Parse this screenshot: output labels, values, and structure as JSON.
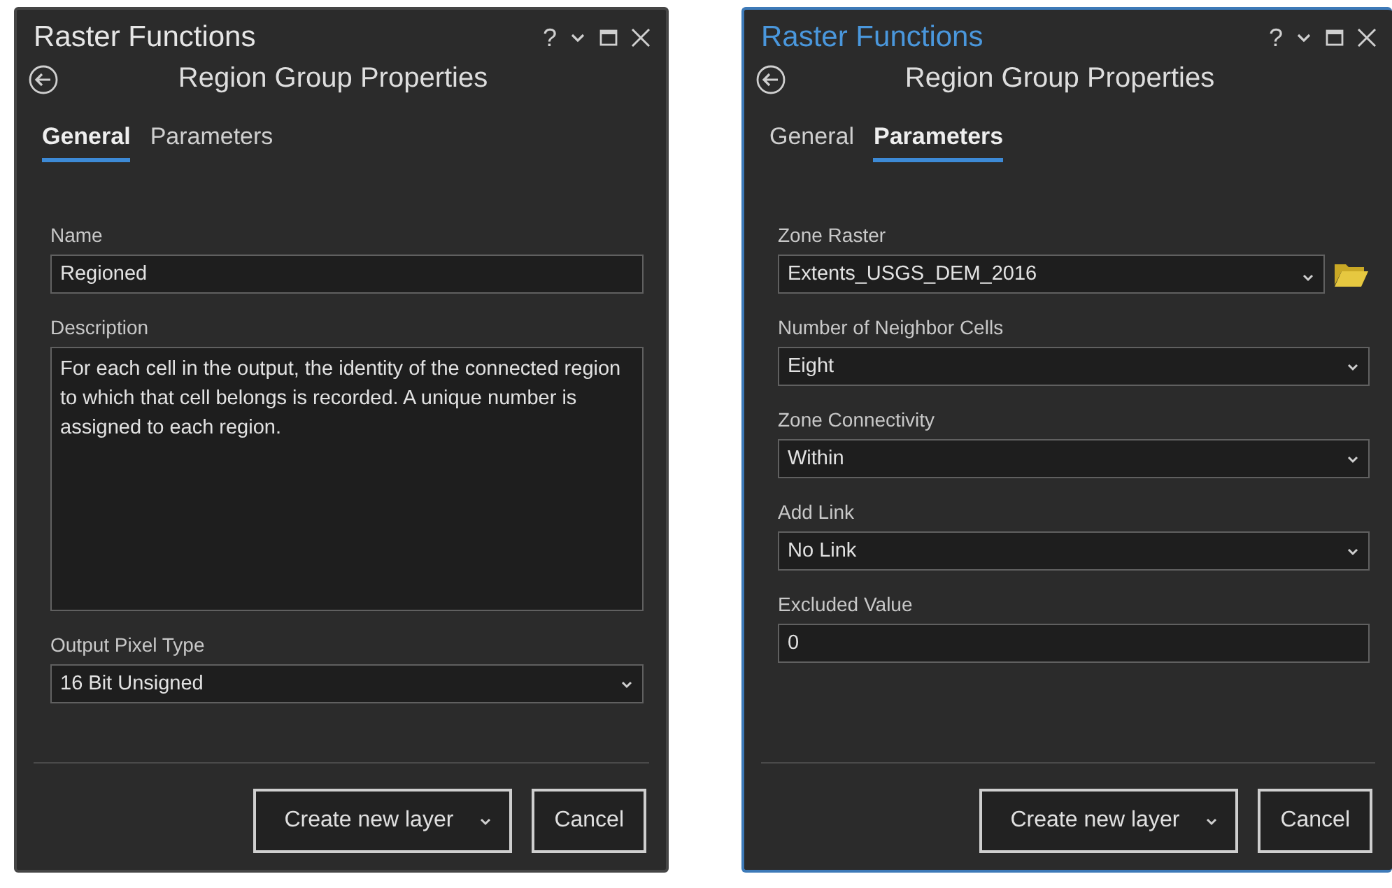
{
  "panels": [
    {
      "title": "Raster Functions",
      "active": false,
      "help": "?",
      "subtitle": "Region Group Properties",
      "tabs": [
        {
          "label": "General",
          "selected": true
        },
        {
          "label": "Parameters",
          "selected": false
        }
      ],
      "fields": [
        {
          "kind": "text",
          "label": "Name",
          "value": "Regioned"
        },
        {
          "kind": "textarea",
          "label": "Description",
          "value": "For each cell in the output, the identity of the connected region to which that cell belongs is recorded. A unique number is assigned to each region."
        },
        {
          "kind": "select",
          "label": "Output Pixel Type",
          "value": "16 Bit Unsigned"
        }
      ],
      "buttons": [
        {
          "label": "Create new layer",
          "kind": "split"
        },
        {
          "label": "Cancel",
          "kind": "plain"
        }
      ]
    },
    {
      "title": "Raster Functions",
      "active": true,
      "help": "?",
      "subtitle": "Region Group Properties",
      "tabs": [
        {
          "label": "General",
          "selected": false
        },
        {
          "label": "Parameters",
          "selected": true
        }
      ],
      "fields": [
        {
          "kind": "browse",
          "label": "Zone Raster",
          "value": "Extents_USGS_DEM_2016"
        },
        {
          "kind": "select",
          "label": "Number of Neighbor Cells",
          "value": "Eight"
        },
        {
          "kind": "select",
          "label": "Zone Connectivity",
          "value": "Within"
        },
        {
          "kind": "select",
          "label": "Add Link",
          "value": "No Link"
        },
        {
          "kind": "text",
          "label": "Excluded Value",
          "value": "0"
        }
      ],
      "buttons": [
        {
          "label": "Create new layer",
          "kind": "split"
        },
        {
          "label": "Cancel",
          "kind": "plain"
        }
      ]
    }
  ]
}
